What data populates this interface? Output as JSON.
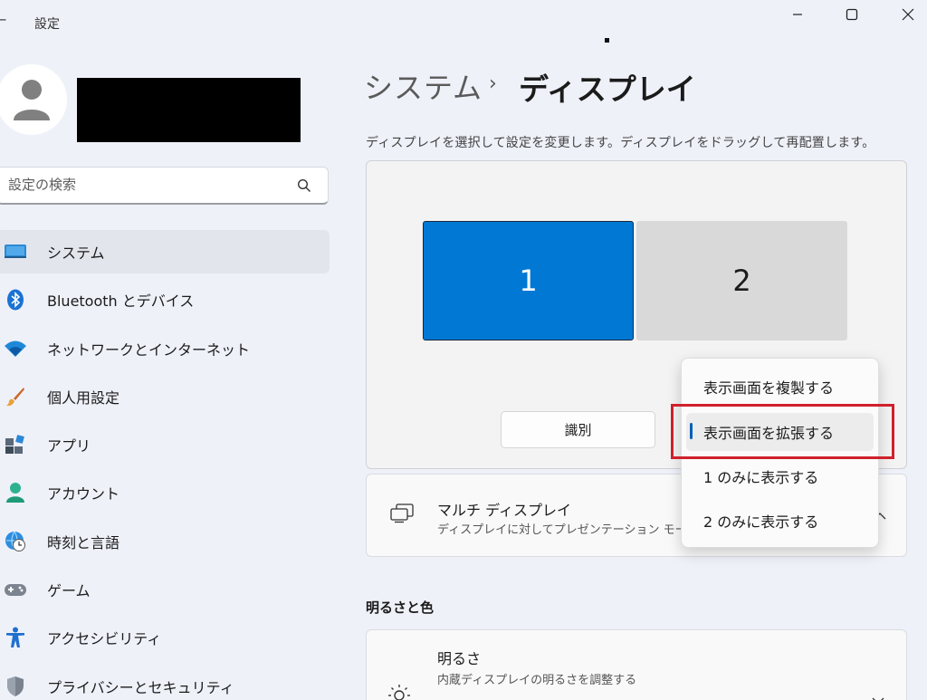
{
  "window": {
    "title": "設定",
    "back_icon": "back-arrow-icon",
    "controls": [
      "minimize-icon",
      "maximize-icon",
      "close-icon"
    ]
  },
  "sidebar": {
    "search": {
      "placeholder": "設定の検索",
      "icon": "search-icon"
    },
    "items": [
      {
        "label": "システム",
        "icon": "system-display-icon",
        "active": true
      },
      {
        "label": "Bluetooth とデバイス",
        "icon": "bluetooth-icon"
      },
      {
        "label": "ネットワークとインターネット",
        "icon": "wifi-icon"
      },
      {
        "label": "個人用設定",
        "icon": "brush-icon"
      },
      {
        "label": "アプリ",
        "icon": "apps-icon"
      },
      {
        "label": "アカウント",
        "icon": "account-icon"
      },
      {
        "label": "時刻と言語",
        "icon": "globe-clock-icon"
      },
      {
        "label": "ゲーム",
        "icon": "gamepad-icon"
      },
      {
        "label": "アクセシビリティ",
        "icon": "accessibility-icon"
      },
      {
        "label": "プライバシーとセキュリティ",
        "icon": "shield-icon"
      }
    ]
  },
  "main": {
    "breadcrumb": {
      "parent": "システム",
      "separator": "›",
      "current": "ディスプレイ"
    },
    "description": "ディスプレイを選択して設定を変更します。ディスプレイをドラッグして再配置します。",
    "monitors": [
      {
        "label": "1",
        "selected": true
      },
      {
        "label": "2",
        "selected": false
      }
    ],
    "identify_button": "識別",
    "multi_display": {
      "title": "マルチ ディスプレイ",
      "subtitle": "ディスプレイに対してプレゼンテーション モードを",
      "icon": "multi-display-icon"
    },
    "section_brightness": "明るさと色",
    "brightness": {
      "title": "明るさ",
      "subtitle": "内蔵ディスプレイの明るさを調整する",
      "icon": "sun-icon"
    }
  },
  "dropdown": {
    "options": [
      "表示画面を複製する",
      "表示画面を拡張する",
      "1 のみに表示する",
      "2 のみに表示する"
    ],
    "selected": "表示画面を拡張する"
  },
  "colors": {
    "accent": "#0078d4",
    "highlight_box": "#d0202c",
    "background": "#eff1f9"
  }
}
